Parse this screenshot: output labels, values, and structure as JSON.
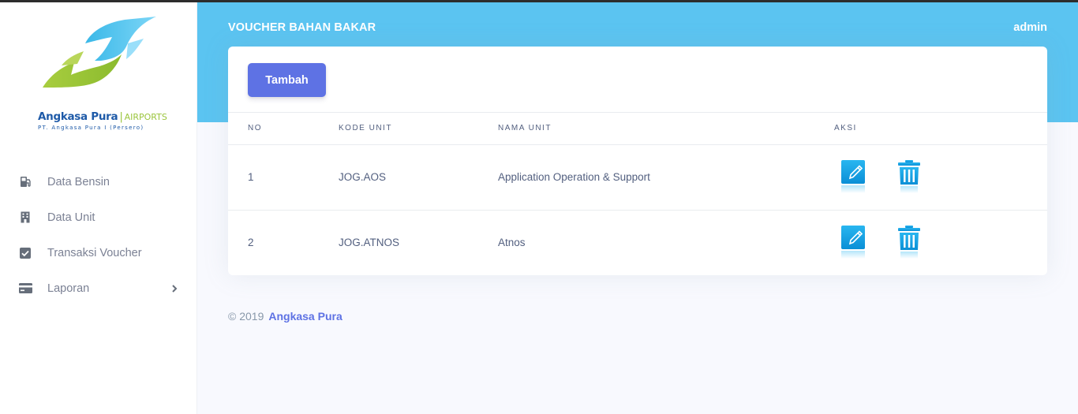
{
  "brand": {
    "name": "Angkasa Pura",
    "separator": "|",
    "tagline": "AIRPORTS",
    "subtitle": "PT. Angkasa Pura I (Persero)"
  },
  "sidebar": {
    "items": [
      {
        "label": "Data Bensin",
        "icon": "fuel-pump-icon"
      },
      {
        "label": "Data Unit",
        "icon": "building-icon"
      },
      {
        "label": "Transaksi Voucher",
        "icon": "checkbox-icon"
      },
      {
        "label": "Laporan",
        "icon": "credit-card-icon",
        "has_submenu": true
      }
    ]
  },
  "header": {
    "title": "VOUCHER BAHAN BAKAR",
    "user": "admin"
  },
  "card": {
    "add_button": "Tambah",
    "columns": [
      "NO",
      "KODE UNIT",
      "NAMA UNIT",
      "AKSI"
    ],
    "rows": [
      {
        "no": "1",
        "kode": "JOG.AOS",
        "nama": "Application Operation & Support"
      },
      {
        "no": "2",
        "kode": "JOG.ATNOS",
        "nama": "Atnos"
      }
    ]
  },
  "footer": {
    "copyright": "© 2019",
    "link": "Angkasa Pura"
  },
  "colors": {
    "header": "#5bc4f1",
    "primary": "#5e72e4",
    "action_icon": "#1aa4e6",
    "logo_blue": "#1e5aa8",
    "logo_green": "#9bc53d"
  }
}
